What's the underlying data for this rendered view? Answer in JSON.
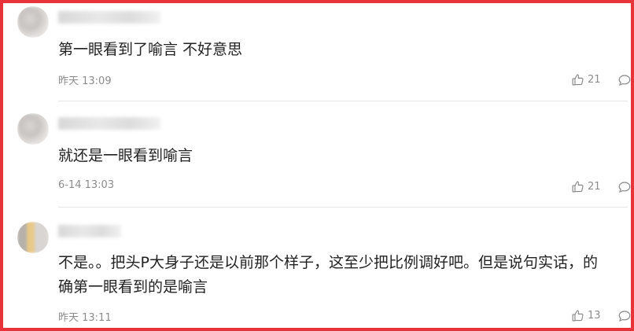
{
  "comments": [
    {
      "text": "第一眼看到了喻言 不好意思",
      "time": "昨天 13:09",
      "likes": "21"
    },
    {
      "text": "就还是一眼看到喻言",
      "time": "6-14 13:03",
      "likes": "21"
    },
    {
      "text": "不是。。把头P大身子还是以前那个样子，这至少把比例调好吧。但是说句实话，的确第一眼看到的是喻言",
      "time": "昨天 13:11",
      "likes": "13"
    }
  ],
  "colors": {
    "frame_border": "#e8333a",
    "meta_text": "#8c8c8c",
    "body_text": "#222222"
  },
  "icons": {
    "like": "thumbs-up-icon",
    "reply": "speech-bubble-icon"
  }
}
